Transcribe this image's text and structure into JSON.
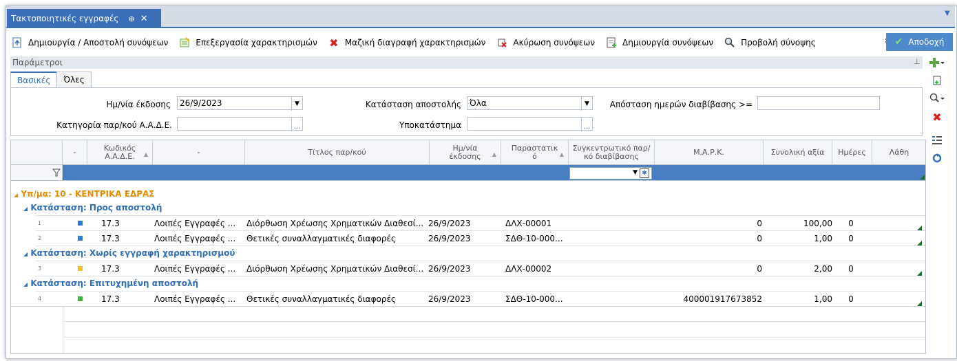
{
  "window": {
    "tab_title": "Τακτοποιητικές εγγραφές",
    "pin_glyph": "⊕",
    "close_glyph": "✕"
  },
  "toolbar": {
    "buttons": [
      {
        "label": "Δημιουργία / Αποστολή συνόψεων",
        "icon": "doc-send-icon"
      },
      {
        "label": "Επεξεργασία χαρακτηρισμών",
        "icon": "edit-sheet-icon"
      },
      {
        "label": "Μαζική διαγραφή χαρακτηρισμών",
        "icon": "red-x-icon"
      },
      {
        "label": "Ακύρωση συνόψεων",
        "icon": "cancel-doc-icon"
      },
      {
        "label": "Δημιουργία συνόψεων",
        "icon": "create-doc-icon"
      },
      {
        "label": "Προβολή σύνοψης",
        "icon": "magnifier-icon"
      }
    ],
    "more_glyph": "»",
    "accept_label": "Αποδοχή"
  },
  "parameters": {
    "title": "Παράμετροι",
    "tabs": [
      "Βασικές",
      "Όλες"
    ],
    "fields": {
      "issue_date_label": "Ημ/νία έκδοσης",
      "issue_date_value": "26/9/2023",
      "send_status_label": "Κατάσταση αποστολής",
      "send_status_value": "Όλα",
      "distance_label": "Απόσταση ημερών διαβίβασης >=",
      "distance_value": "",
      "aade_category_label": "Κατηγορία παρ/κού Α.Α.Δ.Ε.",
      "aade_category_value": "",
      "branch_label": "Υποκατάστημα",
      "branch_value": ""
    }
  },
  "grid": {
    "columns": [
      "-",
      "Κωδικός Α.Α.Δ.Ε.",
      "-",
      "Τίτλος παρ/κού",
      "Ημ/νία έκδοσης",
      "Παραστατικ ό",
      "Συγκεντρωτικό παρ/κό διαβίβασης",
      "Μ.Α.Ρ.Κ.",
      "Συνολική αξία",
      "Ημέρες",
      "Λάθη"
    ],
    "filter_glyph": "▼",
    "group": "Υπ/μα:  10 - ΚΕΝΤΡΙΚΑ ΕΔΡΑΣ",
    "subgroups": [
      {
        "label": "Κατάσταση:  Προς αποστολή",
        "rows": [
          {
            "num": "1",
            "status_color": "#2a7fd4",
            "code": "17.3",
            "type": "Λοιπές Εγγραφές ...",
            "title": "Διόρθωση Χρέωσης Χρηματικών Διαθεσί...",
            "date": "26/9/2023",
            "doc": "ΔΛΧ-00001",
            "mark": "0",
            "total": "100,00",
            "days": "0"
          },
          {
            "num": "2",
            "status_color": "#2a7fd4",
            "code": "17.3",
            "type": "Λοιπές Εγγραφές ...",
            "title": "Θετικές συναλλαγματικές διαφορές",
            "date": "26/9/2023",
            "doc": "ΣΔΘ-10-000...",
            "mark": "0",
            "total": "1,00",
            "days": "0"
          }
        ]
      },
      {
        "label": "Κατάσταση:  Χωρίς εγγραφή χαρακτηρισμού",
        "rows": [
          {
            "num": "3",
            "status_color": "#f0c419",
            "code": "17.3",
            "type": "Λοιπές Εγγραφές ...",
            "title": "Διόρθωση Χρέωσης Χρηματικών Διαθεσί...",
            "date": "26/9/2023",
            "doc": "ΔΛΧ-00002",
            "mark": "0",
            "total": "2,00",
            "days": "0"
          }
        ]
      },
      {
        "label": "Κατάσταση:  Επιτυχημένη αποστολή",
        "rows": [
          {
            "num": "4",
            "status_color": "#3cb83c",
            "code": "17.3",
            "type": "Λοιπές Εγγραφές ...",
            "title": "Θετικές συναλλαγματικές διαφορές",
            "date": "26/9/2023",
            "doc": "ΣΔΘ-10-000...",
            "mark": "400001917673852",
            "total": "1,00",
            "days": "0"
          }
        ]
      }
    ]
  }
}
